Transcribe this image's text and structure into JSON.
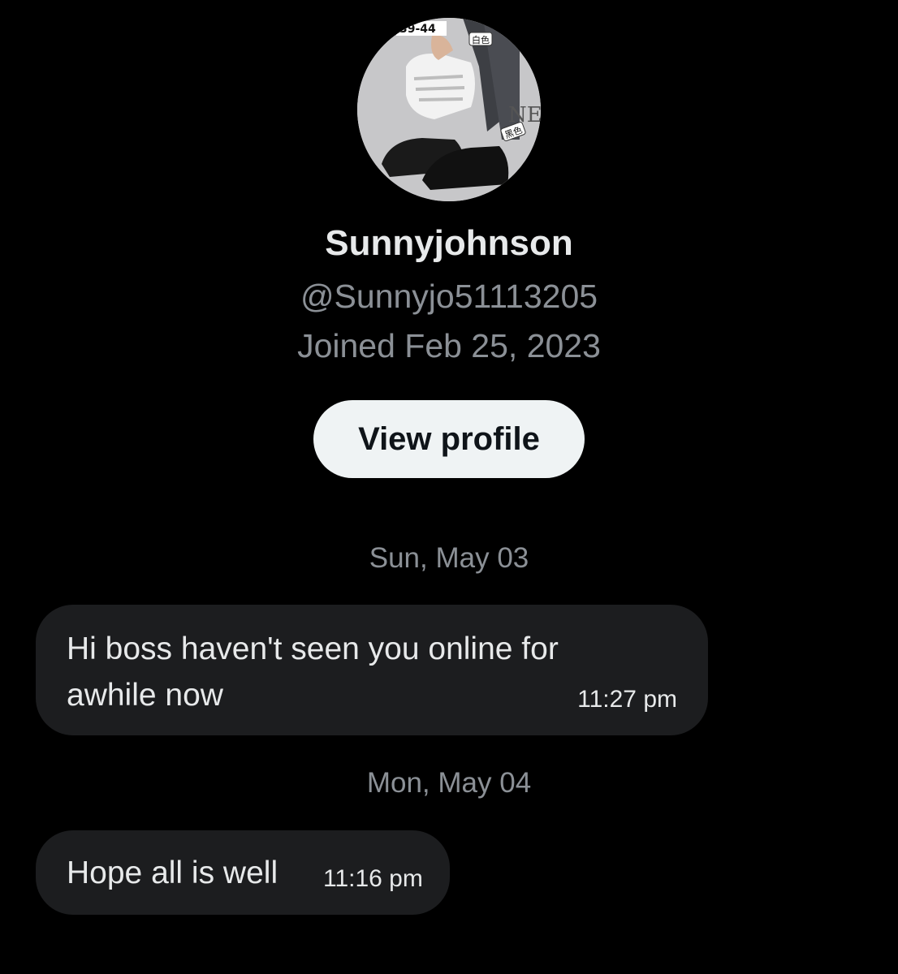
{
  "profile": {
    "display_name": "Sunnyjohnson",
    "handle": "@Sunnyjo51113205",
    "joined": "Joined Feb 25, 2023",
    "view_profile_label": "View profile",
    "avatar_icon": "profile-photo-sneakers",
    "avatar_overlay_text": [
      "39-44",
      "白色",
      "黑色",
      "NE"
    ]
  },
  "conversation": {
    "groups": [
      {
        "date": "Sun, May 03",
        "messages": [
          {
            "line1": "Hi boss haven't seen you online for",
            "line2": "awhile now",
            "time": "11:27 pm"
          }
        ]
      },
      {
        "date": "Mon, May 04",
        "messages": [
          {
            "line1": "Hope all is well",
            "time": "11:16 pm"
          }
        ]
      }
    ]
  },
  "colors": {
    "background": "#000000",
    "bubble": "#1c1d1f",
    "primary_text": "#e7e9ea",
    "secondary_text": "#8b9096",
    "button_bg": "#eff3f4",
    "button_text": "#0f1419"
  }
}
